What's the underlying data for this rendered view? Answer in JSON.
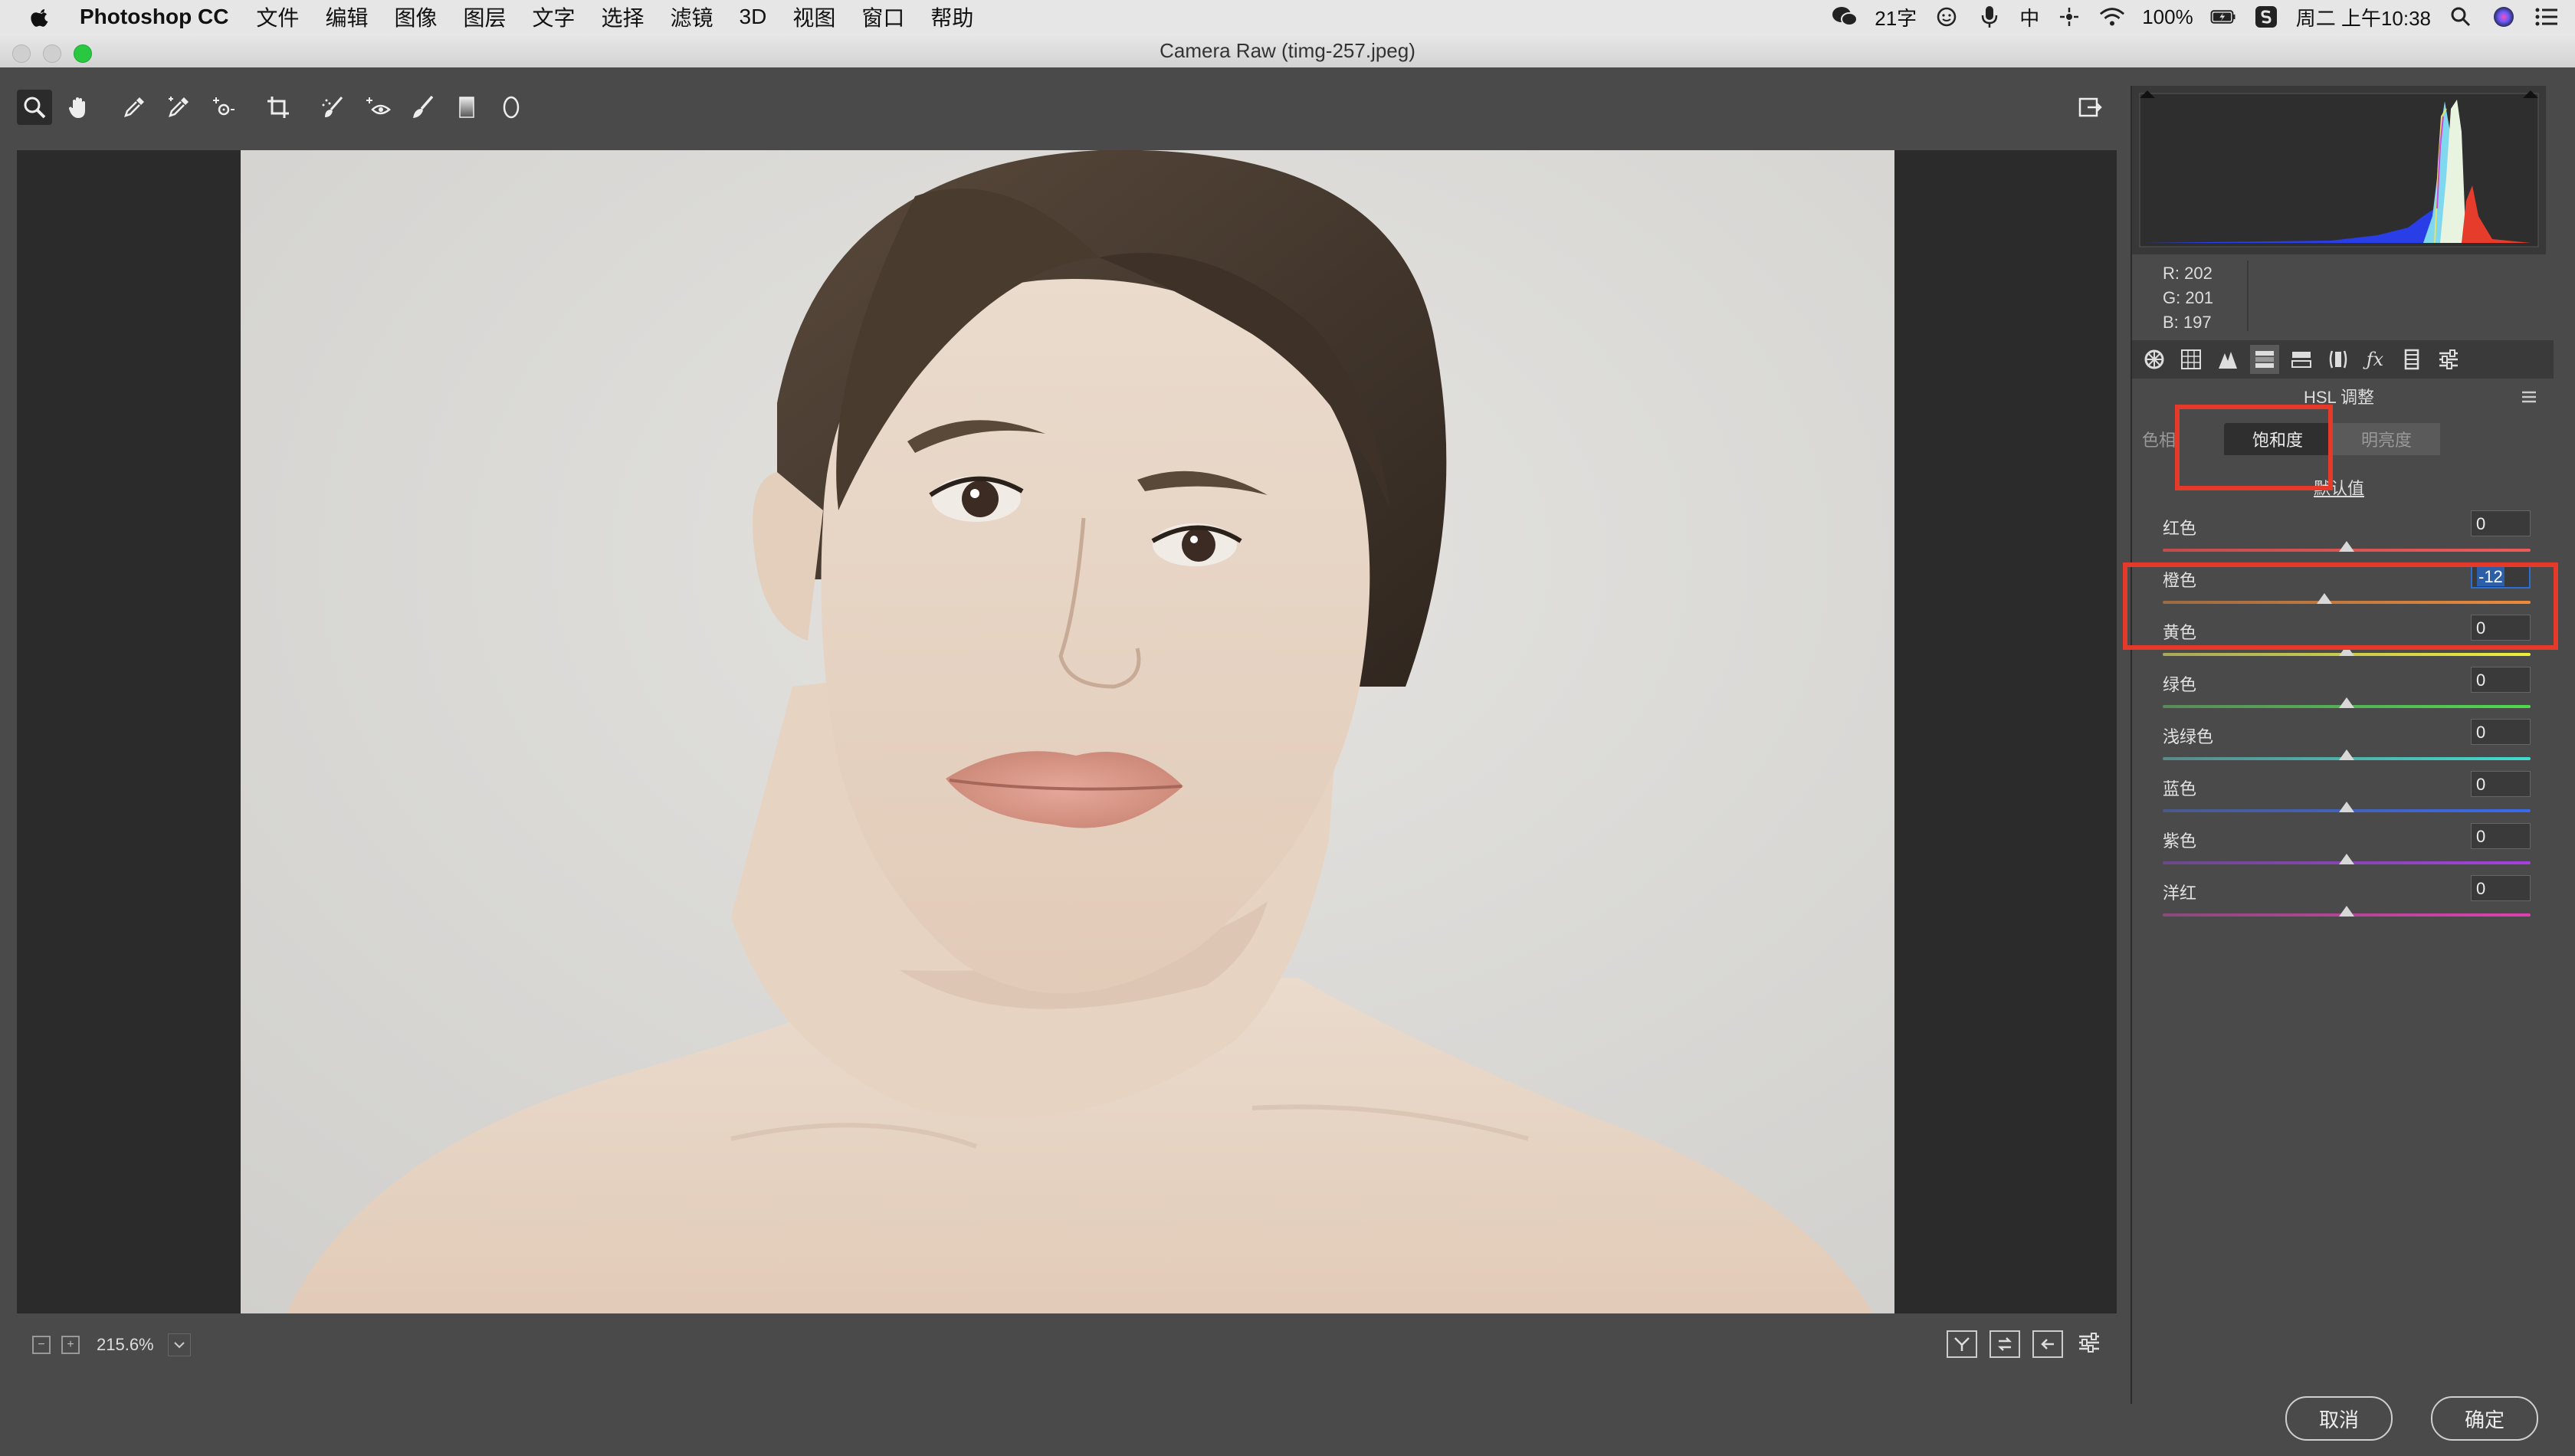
{
  "menubar": {
    "app_name": "Photoshop CC",
    "items": [
      "文件",
      "编辑",
      "图像",
      "图层",
      "文字",
      "选择",
      "滤镜",
      "3D",
      "视图",
      "窗口",
      "帮助"
    ],
    "status": {
      "input_count": "21字",
      "ime": "中",
      "battery": "100%",
      "clock": "周二 上午10:38"
    }
  },
  "window": {
    "title": "Camera Raw (timg-257.jpeg)"
  },
  "status_bar": {
    "zoom": "215.6%"
  },
  "rgb": {
    "r": "R:  202",
    "g": "G:  201",
    "b": "B:  197"
  },
  "panel": {
    "title": "HSL 调整",
    "tabs": [
      "色相",
      "饱和度",
      "明亮度"
    ],
    "selected_tab": "饱和度",
    "defaults_link": "默认值",
    "sliders": [
      {
        "label": "红色",
        "value": "0",
        "colors": [
          "#c44c4c",
          "#ee5a5a"
        ]
      },
      {
        "label": "橙色",
        "value": "-12",
        "colors": [
          "#9b6b44",
          "#ee8a3a"
        ]
      },
      {
        "label": "黄色",
        "value": "0",
        "colors": [
          "#a8a85a",
          "#eeee3a"
        ]
      },
      {
        "label": "绿色",
        "value": "0",
        "colors": [
          "#5a8a5a",
          "#4ddc4d"
        ]
      },
      {
        "label": "浅绿色",
        "value": "0",
        "colors": [
          "#5a8a8a",
          "#40dcd0"
        ]
      },
      {
        "label": "蓝色",
        "value": "0",
        "colors": [
          "#4a5a8a",
          "#3a6aee"
        ]
      },
      {
        "label": "紫色",
        "value": "0",
        "colors": [
          "#6a4a8a",
          "#a640e0"
        ]
      },
      {
        "label": "洋红",
        "value": "0",
        "colors": [
          "#8a4a7a",
          "#e040b0"
        ]
      }
    ]
  },
  "buttons": {
    "cancel": "取消",
    "ok": "确定"
  },
  "colors": {
    "highlight_box": "#e53a2a",
    "focus_blue": "#2a6fd6"
  }
}
